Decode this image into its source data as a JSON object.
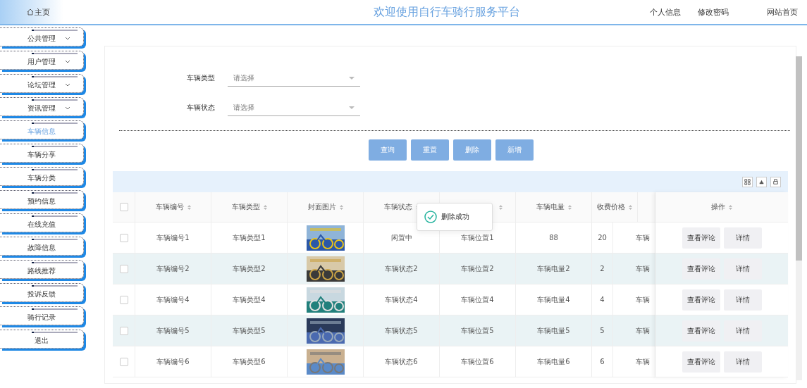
{
  "header": {
    "home": "主页",
    "title": "欢迎使用自行车骑行服务平台",
    "links": [
      "个人信息",
      "修改密码",
      "网站首页"
    ]
  },
  "sidebar": {
    "items": [
      {
        "label": "公共管理",
        "kind": "group",
        "selected": false
      },
      {
        "label": "用户管理",
        "kind": "group",
        "selected": false
      },
      {
        "label": "论坛管理",
        "kind": "group",
        "selected": false
      },
      {
        "label": "资讯管理",
        "kind": "group",
        "selected": false
      },
      {
        "label": "车辆信息",
        "kind": "link",
        "selected": true
      },
      {
        "label": "车辆分享",
        "kind": "link",
        "selected": false
      },
      {
        "label": "车辆分类",
        "kind": "link",
        "selected": false
      },
      {
        "label": "预约信息",
        "kind": "link",
        "selected": false
      },
      {
        "label": "在线充值",
        "kind": "link",
        "selected": false
      },
      {
        "label": "故障信息",
        "kind": "link",
        "selected": false
      },
      {
        "label": "路线推荐",
        "kind": "link",
        "selected": false
      },
      {
        "label": "投诉反馈",
        "kind": "link",
        "selected": false
      },
      {
        "label": "骑行记录",
        "kind": "link",
        "selected": false
      },
      {
        "label": "退出",
        "kind": "link",
        "selected": false
      }
    ]
  },
  "filters": [
    {
      "label": "车辆类型",
      "placeholder": "请选择"
    },
    {
      "label": "车辆状态",
      "placeholder": "请选择"
    }
  ],
  "buttons": [
    "查询",
    "重置",
    "删除",
    "新增"
  ],
  "table": {
    "columns": [
      "车辆编号",
      "车辆类型",
      "封面图片",
      "车辆状态",
      "",
      "车辆电量",
      "收费价格"
    ],
    "action_column": "操作",
    "rows": [
      {
        "checked": false,
        "cells": [
          "车辆编号1",
          "车辆类型1",
          {
            "kind": "picture"
          },
          "闲置中",
          "车辆位置1",
          "88",
          "20",
          "车辆"
        ],
        "actions": [
          "查看评论",
          "详情"
        ]
      },
      {
        "checked": false,
        "cells": [
          "车辆编号2",
          "车辆类型2",
          {
            "kind": "picture"
          },
          "车辆状态2",
          "车辆位置2",
          "车辆电量2",
          "2",
          "车辆"
        ],
        "actions": [
          "查看评论",
          "详情"
        ]
      },
      {
        "checked": false,
        "cells": [
          "车辆编号4",
          "车辆类型4",
          {
            "kind": "picture"
          },
          "车辆状态4",
          "车辆位置4",
          "车辆电量4",
          "4",
          "车辆"
        ],
        "actions": [
          "查看评论",
          "详情"
        ]
      },
      {
        "checked": false,
        "cells": [
          "车辆编号5",
          "车辆类型5",
          {
            "kind": "picture"
          },
          "车辆状态5",
          "车辆位置5",
          "车辆电量5",
          "5",
          "车辆"
        ],
        "actions": [
          "查看评论",
          "详情"
        ]
      },
      {
        "checked": false,
        "cells": [
          "车辆编号6",
          "车辆类型6",
          {
            "kind": "picture"
          },
          "车辆状态6",
          "车辆位置6",
          "车辆电量6",
          "6",
          "车辆"
        ],
        "actions": [
          "查看评论",
          "详情"
        ]
      }
    ],
    "select_all_checked": false
  },
  "toast": {
    "message": "删除成功"
  }
}
